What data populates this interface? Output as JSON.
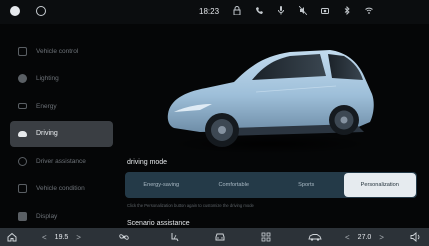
{
  "statusbar": {
    "time": "18:23",
    "icons": [
      "user-avatar-icon",
      "ring-icon",
      "lock-icon",
      "phone-icon",
      "mic-icon",
      "mute-icon",
      "camera-icon",
      "bluetooth-icon",
      "wifi-icon"
    ]
  },
  "sidebar": {
    "items": [
      {
        "label": "Vehicle control",
        "icon": "car-control-icon"
      },
      {
        "label": "Lighting",
        "icon": "light-icon"
      },
      {
        "label": "Energy",
        "icon": "battery-icon"
      },
      {
        "label": "Driving",
        "icon": "car-icon",
        "active": true
      },
      {
        "label": "Driver assistance",
        "icon": "steering-icon"
      },
      {
        "label": "Vehicle condition",
        "icon": "condition-icon"
      },
      {
        "label": "Display",
        "icon": "display-icon"
      }
    ]
  },
  "main": {
    "driving_mode_title": "driving mode",
    "modes": [
      "Energy-saving",
      "Comfortable",
      "Sports",
      "Personalization"
    ],
    "selected_mode": "Personalization",
    "hint": "Click the Personalization button again to customize the driving mode",
    "scenario_title": "Scenario assistance"
  },
  "dock": {
    "left_temp": "19.5",
    "right_temp": "27.0",
    "left_chevron_prev": "<",
    "left_chevron_next": ">",
    "right_chevron_prev": "<",
    "right_chevron_next": ">"
  },
  "colors": {
    "accent": "#e6ebef",
    "mode_bar": "#243a48",
    "car_body": "#9ebfd9"
  }
}
